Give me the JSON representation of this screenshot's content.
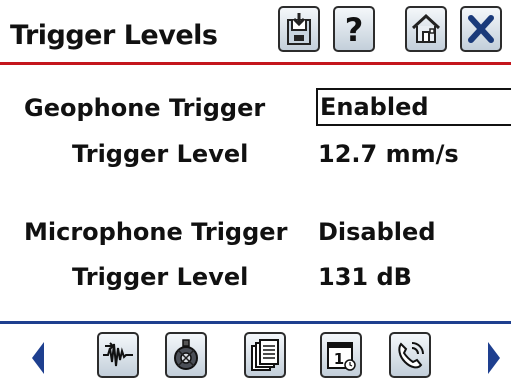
{
  "header": {
    "title": "Trigger Levels",
    "buttons": [
      {
        "icon": "save-icon"
      },
      {
        "icon": "help-icon"
      },
      {
        "icon": "home-icon"
      },
      {
        "icon": "close-icon"
      }
    ]
  },
  "geophone": {
    "label": "Geophone Trigger",
    "value": "Enabled",
    "level_label": "Trigger Level",
    "level_value": "12.7 mm/s"
  },
  "microphone": {
    "label": "Microphone Trigger",
    "value": "Disabled",
    "level_label": "Trigger Level",
    "level_value": "131 dB"
  },
  "footer": {
    "buttons": [
      {
        "icon": "waveform-icon"
      },
      {
        "icon": "sensor-icon"
      },
      {
        "icon": "documents-icon"
      },
      {
        "icon": "calendar-icon"
      },
      {
        "icon": "phone-icon"
      }
    ]
  },
  "colors": {
    "header_rule": "#c4161c",
    "footer_rule": "#1e3f8f",
    "arrow": "#1e3f8f",
    "icon_frame": "#2c2c2c",
    "icon_fill_top": "#f4f7fa",
    "icon_fill_bottom": "#c3cfda"
  }
}
